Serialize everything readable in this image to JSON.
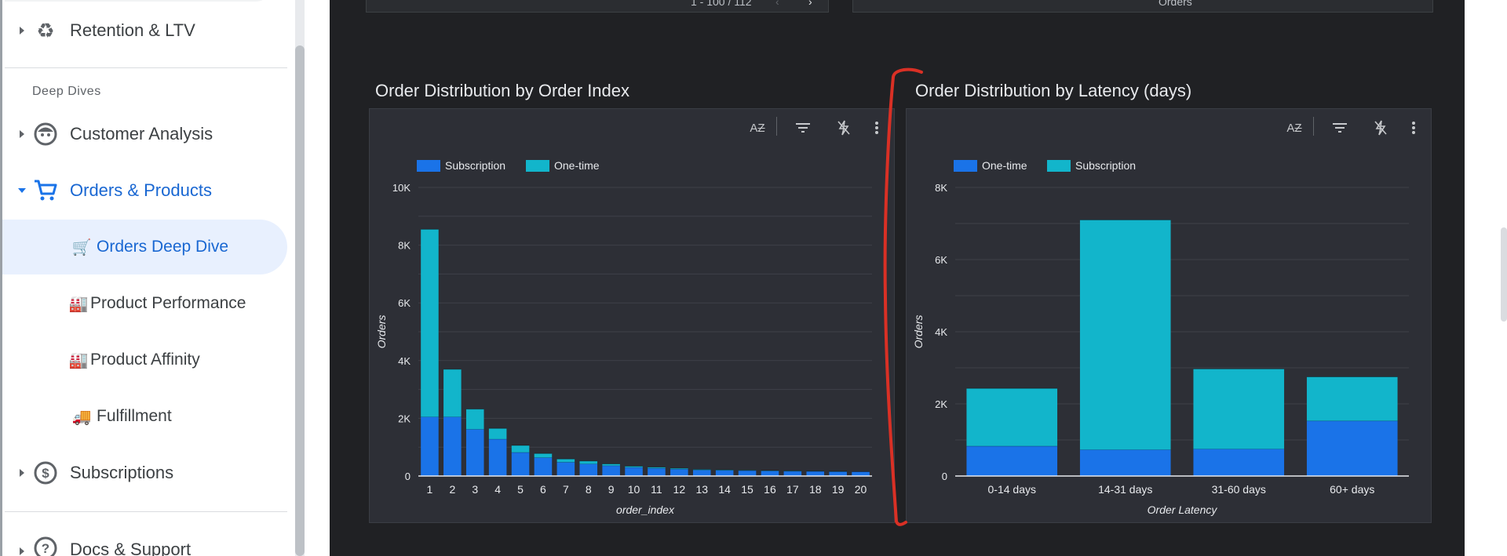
{
  "sidebar": {
    "retention": "Retention & LTV",
    "deep_dives_header": "Deep Dives",
    "customer_analysis": "Customer Analysis",
    "orders_products": "Orders & Products",
    "sub_items": [
      {
        "label": "Orders Deep Dive",
        "icon": "🛒"
      },
      {
        "label": "Product Performance",
        "icon": "🏭"
      },
      {
        "label": "Product Affinity",
        "icon": "🏭"
      },
      {
        "label": "Fulfillment",
        "icon": "🚚"
      }
    ],
    "subscriptions": "Subscriptions",
    "docs_support": "Docs & Support"
  },
  "top_cards": {
    "left_text": "1 - 100 / 112",
    "right_text": "Orders"
  },
  "colors": {
    "subscription": "#1a73e8",
    "one_time": "#12b5cb",
    "annotation": "#d93025"
  },
  "chart_data": [
    {
      "type": "bar",
      "stacked": true,
      "title": "Order Distribution by Order Index",
      "xlabel": "order_index",
      "ylabel": "Orders",
      "ylim": [
        0,
        10000
      ],
      "yticks": [
        "0",
        "2K",
        "4K",
        "6K",
        "8K",
        "10K"
      ],
      "categories": [
        "1",
        "2",
        "3",
        "4",
        "5",
        "6",
        "7",
        "8",
        "9",
        "10",
        "11",
        "12",
        "13",
        "14",
        "15",
        "16",
        "17",
        "18",
        "19",
        "20"
      ],
      "legend_position": "top-left",
      "series": [
        {
          "name": "Subscription",
          "color": "#1a73e8",
          "values": [
            2050,
            2050,
            1620,
            1280,
            820,
            640,
            480,
            420,
            360,
            300,
            270,
            240,
            210,
            200,
            190,
            180,
            170,
            165,
            155,
            150
          ]
        },
        {
          "name": "One-time",
          "color": "#12b5cb",
          "values": [
            6500,
            1650,
            700,
            370,
            240,
            140,
            110,
            100,
            60,
            40,
            35,
            30,
            20,
            15,
            10,
            10,
            10,
            5,
            5,
            0
          ]
        }
      ]
    },
    {
      "type": "bar",
      "stacked": true,
      "title": "Order Distribution by Latency (days)",
      "xlabel": "Order Latency",
      "ylabel": "Orders",
      "ylim": [
        0,
        8000
      ],
      "yticks": [
        "0",
        "2K",
        "4K",
        "6K",
        "8K"
      ],
      "categories": [
        "0-14 days",
        "14-31 days",
        "31-60 days",
        "60+ days"
      ],
      "legend_position": "top-left",
      "series": [
        {
          "name": "One-time",
          "color": "#1a73e8",
          "values": [
            830,
            730,
            750,
            1530
          ]
        },
        {
          "name": "Subscription",
          "color": "#12b5cb",
          "values": [
            1600,
            6370,
            2220,
            1220
          ]
        }
      ]
    }
  ]
}
